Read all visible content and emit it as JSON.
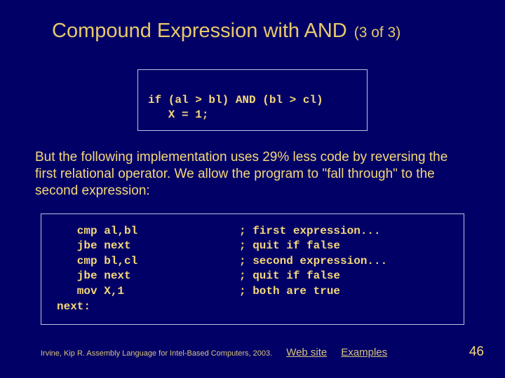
{
  "title": "Compound Expression with AND",
  "pager": "(3 of 3)",
  "pseudo": {
    "line1": "if (al > bl) AND (bl > cl)",
    "line2": "   X = 1;"
  },
  "paragraph": "But the following implementation uses  29% less code by reversing the first relational operator. We allow the program to \"fall through\" to the second expression:",
  "code": {
    "rows": [
      {
        "instr": "   cmp al,bl",
        "cmt": "; first expression..."
      },
      {
        "instr": "   jbe next",
        "cmt": "; quit if false"
      },
      {
        "instr": "   cmp bl,cl",
        "cmt": "; second expression..."
      },
      {
        "instr": "   jbe next",
        "cmt": "; quit if false"
      },
      {
        "instr": "   mov X,1",
        "cmt": "; both are true"
      }
    ],
    "label": "next:"
  },
  "footer": {
    "citation": "Irvine, Kip R. Assembly Language for Intel-Based Computers, 2003.",
    "link1": "Web site",
    "link2": "Examples",
    "pagenum": "46"
  }
}
